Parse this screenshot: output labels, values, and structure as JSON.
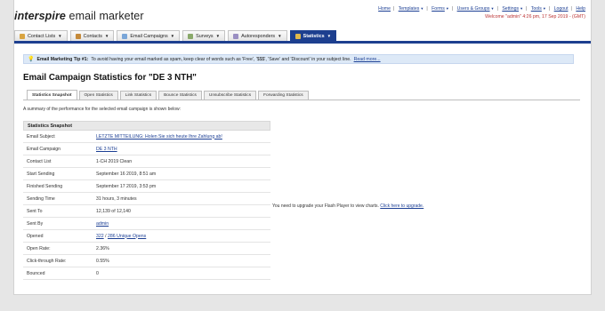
{
  "header": {
    "logo_brand": "interspire",
    "logo_product": "email marketer",
    "links": [
      {
        "label": "Home",
        "dropdown": false
      },
      {
        "label": "Templates",
        "dropdown": true
      },
      {
        "label": "Forms",
        "dropdown": true
      },
      {
        "label": "Users & Groups",
        "dropdown": true
      },
      {
        "label": "Settings",
        "dropdown": true
      },
      {
        "label": "Tools",
        "dropdown": true
      },
      {
        "label": "Logout",
        "dropdown": false
      },
      {
        "label": "Help",
        "dropdown": false
      }
    ],
    "welcome": "Welcome \"admin\" 4:26 pm, 17 Sep 2019 - (GMT)"
  },
  "nav": {
    "tabs": [
      {
        "label": "Contact Lists",
        "icon": "contact-lists-icon",
        "color": "#d9a441"
      },
      {
        "label": "Contacts",
        "icon": "contacts-icon",
        "color": "#c58a3a"
      },
      {
        "label": "Email Campaigns",
        "icon": "email-campaigns-icon",
        "color": "#7aa6d8"
      },
      {
        "label": "Surveys",
        "icon": "surveys-icon",
        "color": "#8aa96a"
      },
      {
        "label": "Autoresponders",
        "icon": "autoresponders-icon",
        "color": "#9a8fc2"
      },
      {
        "label": "Statistics",
        "icon": "statistics-icon",
        "color": "#e0b84c"
      }
    ],
    "active_index": 5,
    "accent": "#1d3f8f"
  },
  "tip": {
    "prefix": "Email Marketing Tip #1:",
    "text": "To avoid having your email marked as spam, keep clear of words such as 'Free', '$$$', 'Save' and 'Discount' in your subject line.",
    "link": "Read more..."
  },
  "page_title": "Email Campaign Statistics for \"DE 3 NTH\"",
  "tabs": [
    "Statistics Snapshot",
    "Open Statistics",
    "Link Statistics",
    "Bounce Statistics",
    "Unsubscribe Statistics",
    "Forwarding Statistics"
  ],
  "summary": "A summary of the performance for the selected email campaign is shown below:",
  "snapshot": {
    "heading": "Statistics Snapshot",
    "rows": [
      {
        "label": "Email Subject",
        "value": "LETZTE MITTEILUNG: Holen Sie sich heute Ihre Zahlung ab!",
        "link": true
      },
      {
        "label": "Email Campaign",
        "value": "DE 3 NTH",
        "link": true
      },
      {
        "label": "Contact List",
        "value": "1-CH 2019 Clean",
        "link": false
      },
      {
        "label": "Start Sending",
        "value": "September 16 2019, 8:51 am",
        "link": false
      },
      {
        "label": "Finished Sending",
        "value": "September 17 2019, 3:53 pm",
        "link": false
      },
      {
        "label": "Sending Time",
        "value": "31 hours, 3 minutes",
        "link": false
      },
      {
        "label": "Sent To",
        "value": "12,139 of 12,140",
        "link": false
      },
      {
        "label": "Sent By",
        "value": "admin",
        "link": true
      },
      {
        "label": "Opened",
        "value_a": "322",
        "sep": " / ",
        "value_b": "286 Unique Opens",
        "link": true
      },
      {
        "label": "Open Rate:",
        "value": "2.36%",
        "link": false
      },
      {
        "label": "Click-through Rate:",
        "value": "0.55%",
        "link": false
      },
      {
        "label": "Bounced",
        "value": "0",
        "link": false
      }
    ]
  },
  "flash": {
    "text": "You need to upgrade your Flash Player to view charts.",
    "link": "Click here to upgrade."
  }
}
